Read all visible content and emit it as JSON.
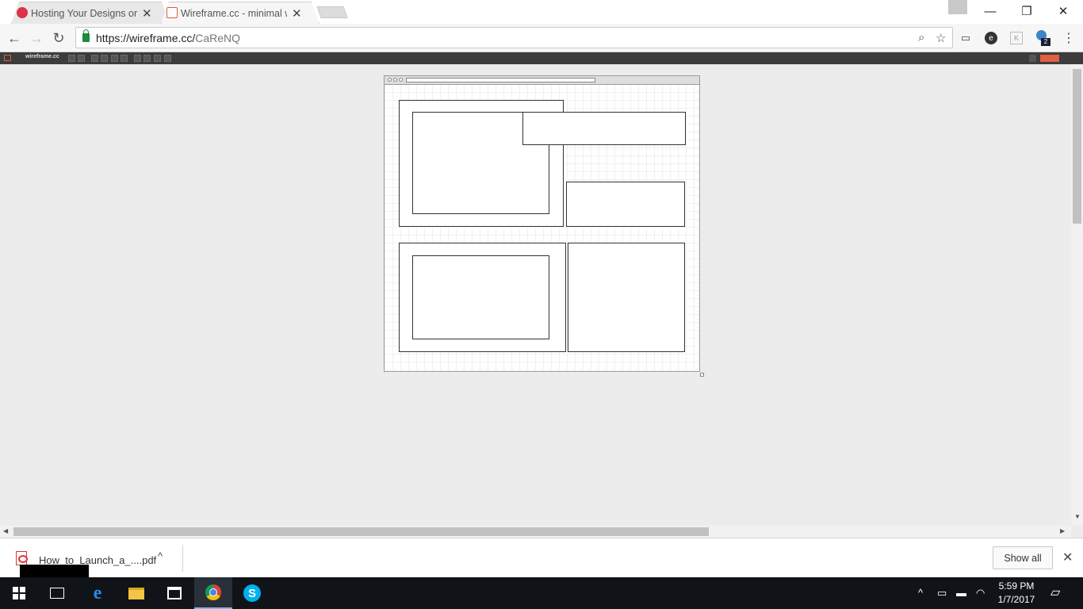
{
  "tabs": [
    {
      "title": "Hosting Your Designs on",
      "close": "✕"
    },
    {
      "title": "Wireframe.cc - minimal w",
      "close": "✕"
    }
  ],
  "window_controls": {
    "minimize": "—",
    "restore": "❐",
    "close": "✕"
  },
  "nav": {
    "back": "←",
    "forward": "→",
    "reload": "↻"
  },
  "address": {
    "host": "https://wireframe.cc/",
    "path": "CaReNQ"
  },
  "omnibox_icons": {
    "zoom": "⌕",
    "bookmark": "☆"
  },
  "extensions": {
    "badge_count": "2"
  },
  "app": {
    "logo": "wireframe.cc"
  },
  "download": {
    "filename": "How_to_Launch_a_....pdf",
    "chevron": "^",
    "show_all": "Show all",
    "close": "✕"
  },
  "taskbar": {
    "time": "5:59 PM",
    "date": "1/7/2017",
    "tray_chevron": "^"
  },
  "colors": {
    "accent": "#e05a3a",
    "toolbar": "#3c3c3c",
    "canvas": "#ececec",
    "taskbar": "#101418"
  }
}
